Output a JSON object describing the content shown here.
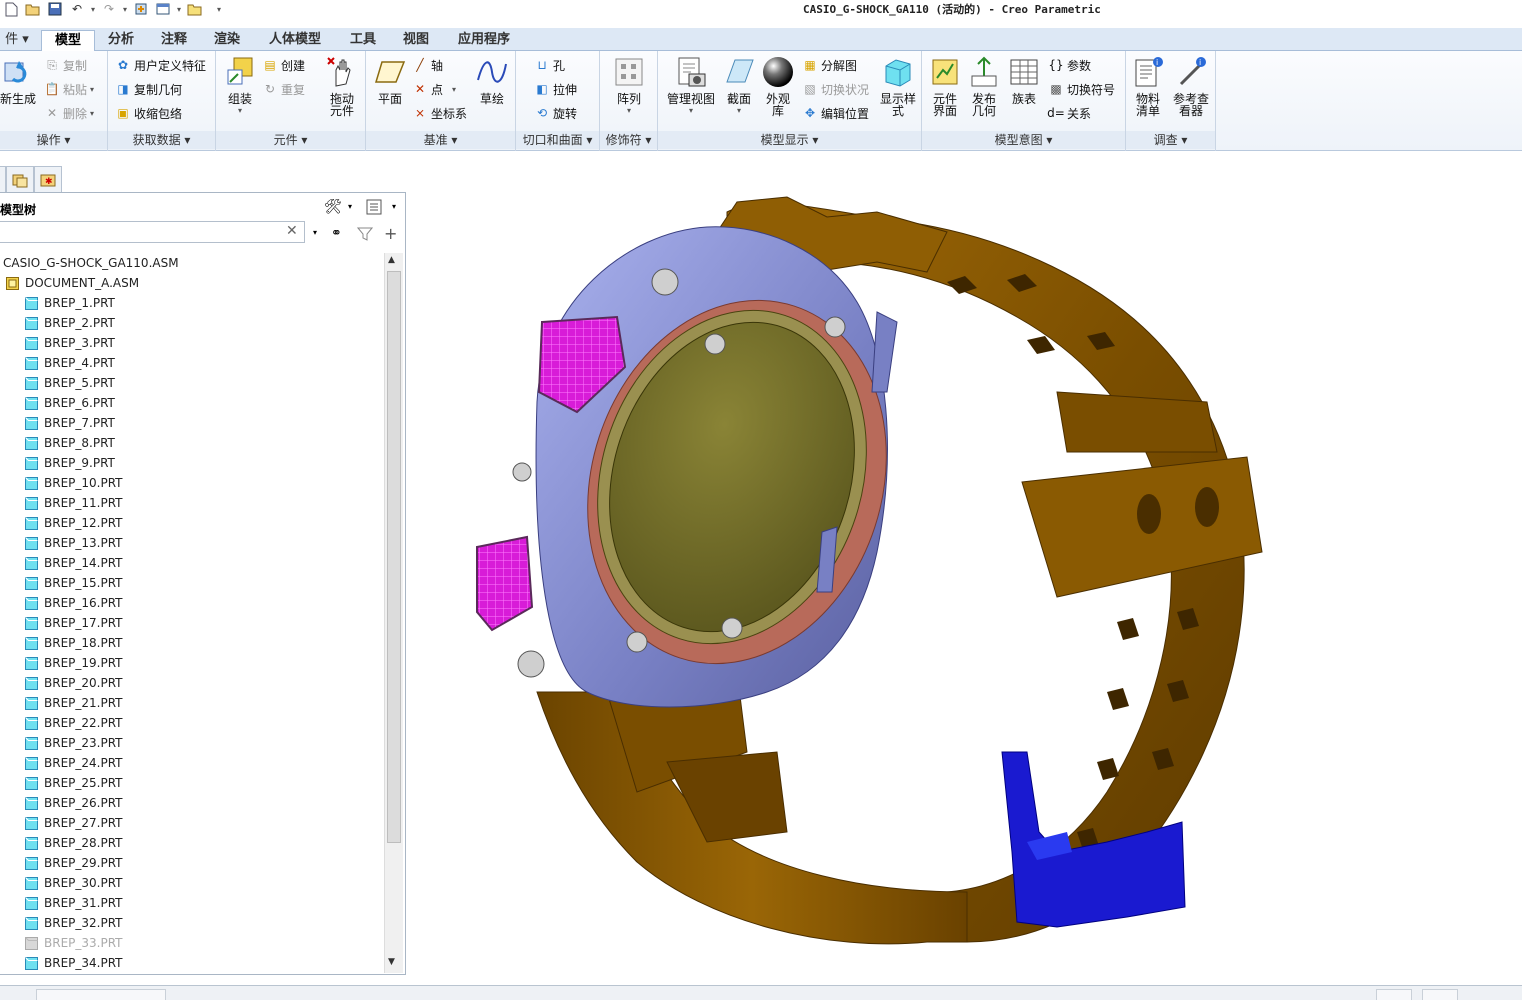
{
  "window": {
    "title": "CASIO_G-SHOCK_GA110 (活动的) - Creo Parametric"
  },
  "quick_access": {
    "icons": [
      "new-icon",
      "open-icon",
      "save-icon",
      "undo-icon",
      "redo-icon",
      "regenerate-icon",
      "window-icon",
      "close-icon",
      "customize-icon"
    ]
  },
  "tabs": [
    {
      "label": "件 ▾",
      "active": false
    },
    {
      "label": "模型",
      "active": true
    },
    {
      "label": "分析",
      "active": false
    },
    {
      "label": "注释",
      "active": false
    },
    {
      "label": "渲染",
      "active": false
    },
    {
      "label": "人体模型",
      "active": false
    },
    {
      "label": "工具",
      "active": false
    },
    {
      "label": "视图",
      "active": false
    },
    {
      "label": "应用程序",
      "active": false
    }
  ],
  "ribbon": {
    "operations": {
      "footer": "操作 ▾",
      "regenerate": "新生成",
      "copy": "复制",
      "paste": "粘贴",
      "delete": "删除"
    },
    "get_data": {
      "footer": "获取数据 ▾",
      "udf": "用户定义特征",
      "copy_geom": "复制几何",
      "shrinkwrap": "收缩包络"
    },
    "component": {
      "footer": "元件 ▾",
      "assemble": "组装",
      "create": "创建",
      "repeat": "重复",
      "drag_1": "拖动",
      "drag_2": "元件"
    },
    "datum": {
      "footer": "基准 ▾",
      "plane": "平面",
      "axis": "轴",
      "point": "点",
      "csys": "坐标系",
      "sketch": "草绘"
    },
    "cut_surface": {
      "footer": "切口和曲面 ▾",
      "hole": "孔",
      "extrude": "拉伸",
      "revolve": "旋转"
    },
    "modifiers": {
      "footer": "修饰符 ▾",
      "pattern": "阵列"
    },
    "model_display": {
      "footer": "模型显示 ▾",
      "manage_views": "管理视图",
      "section": "截面",
      "appearance_1": "外观",
      "appearance_2": "库",
      "explode": "分解图",
      "toggle_status": "切换状况",
      "edit_position": "编辑位置",
      "display_style_1": "显示样",
      "display_style_2": "式"
    },
    "model_intent": {
      "footer": "模型意图 ▾",
      "comp_iface_1": "元件",
      "comp_iface_2": "界面",
      "publish_1": "发布",
      "publish_2": "几何",
      "family_table": "族表",
      "params": "参数",
      "switch_symbols": "切换符号",
      "relations": "关系"
    },
    "investigate": {
      "footer": "调查 ▾",
      "bom_1": "物料",
      "bom_2": "清单",
      "ref_viewer_1": "参考查",
      "ref_viewer_2": "看器"
    }
  },
  "view_toolbar": {
    "icons": [
      "refit-icon",
      "zoom-in-icon",
      "zoom-out-icon",
      "repaint-icon",
      "display-style-icon",
      "saved-views-icon",
      "perspective-icon",
      "datum-display-icon",
      "spin-center-icon",
      "annotation-display-icon",
      "explode-icon"
    ]
  },
  "model_tree": {
    "title": "模型树",
    "search_value": "",
    "root": "CASIO_G-SHOCK_GA110.ASM",
    "sub_asm": "DOCUMENT_A.ASM",
    "parts": [
      "BREP_1.PRT",
      "BREP_2.PRT",
      "BREP_3.PRT",
      "BREP_4.PRT",
      "BREP_5.PRT",
      "BREP_6.PRT",
      "BREP_7.PRT",
      "BREP_8.PRT",
      "BREP_9.PRT",
      "BREP_10.PRT",
      "BREP_11.PRT",
      "BREP_12.PRT",
      "BREP_13.PRT",
      "BREP_14.PRT",
      "BREP_15.PRT",
      "BREP_16.PRT",
      "BREP_17.PRT",
      "BREP_18.PRT",
      "BREP_19.PRT",
      "BREP_20.PRT",
      "BREP_21.PRT",
      "BREP_22.PRT",
      "BREP_23.PRT",
      "BREP_24.PRT",
      "BREP_25.PRT",
      "BREP_26.PRT",
      "BREP_27.PRT",
      "BREP_28.PRT",
      "BREP_29.PRT",
      "BREP_30.PRT",
      "BREP_31.PRT",
      "BREP_32.PRT",
      "BREP_33.PRT",
      "BREP_34.PRT"
    ],
    "dimmed_part": "BREP_33.PRT"
  },
  "colors": {
    "strap": "#8a5a00",
    "case": "#7a84c9",
    "buttons": "#d21dd2",
    "caseback": "#6b6624",
    "clasp": "#1a1ad0",
    "ring": "#b56a5a"
  }
}
